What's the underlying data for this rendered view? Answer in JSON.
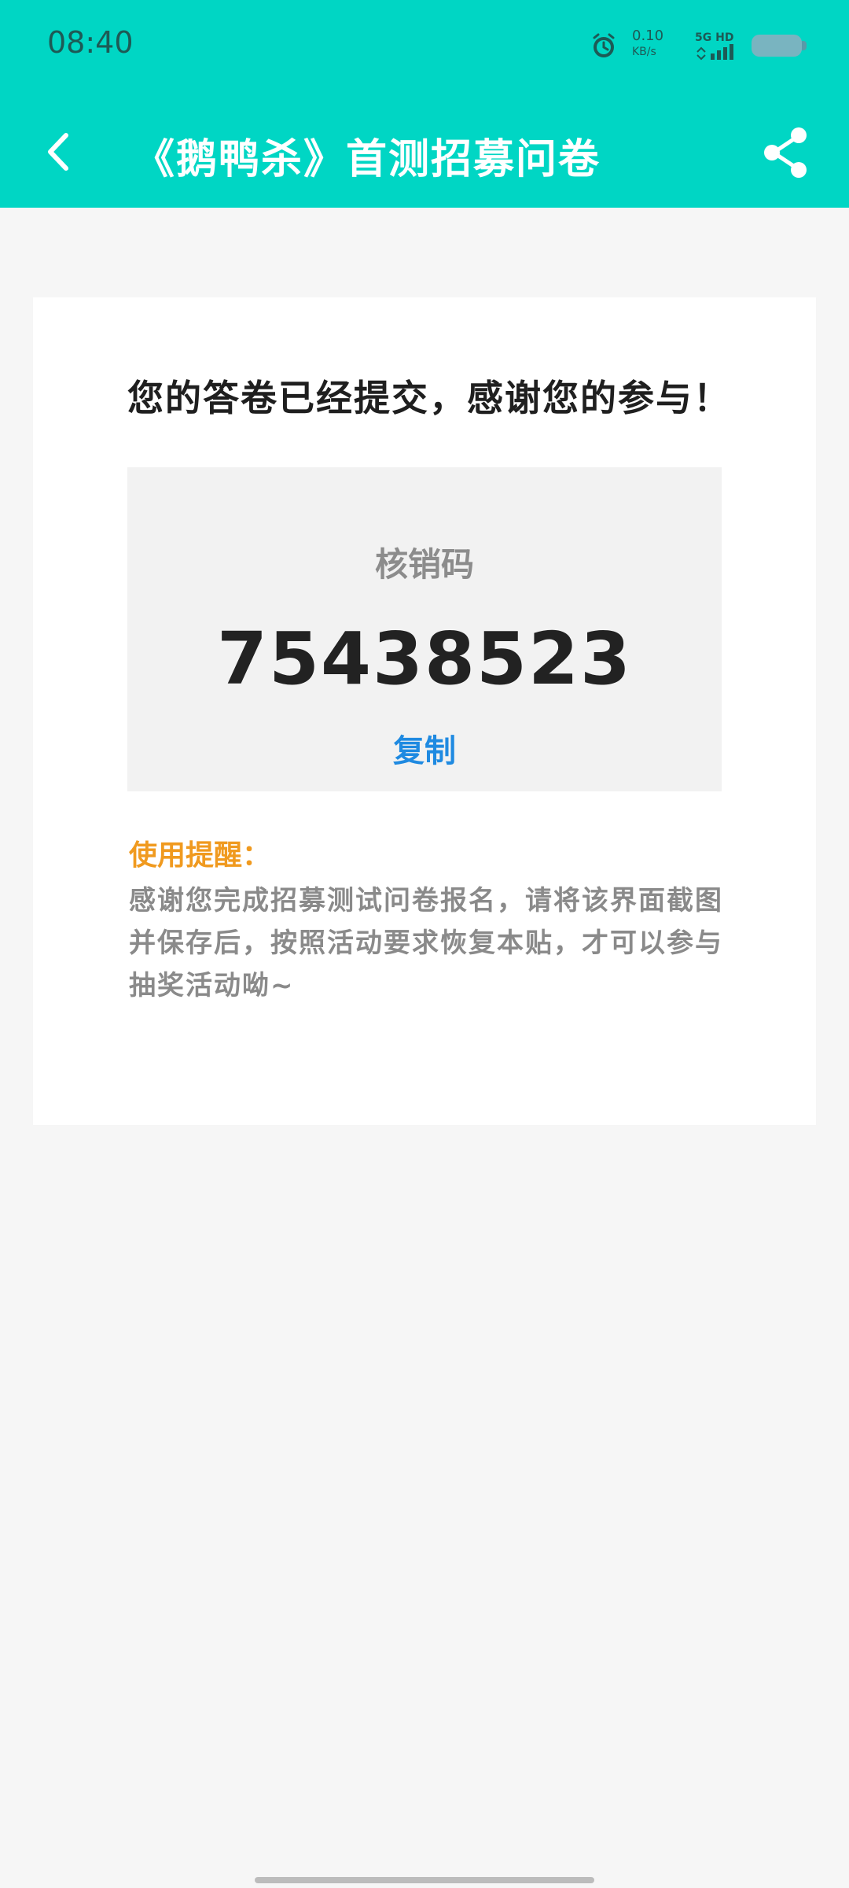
{
  "status_bar": {
    "time": "08:40",
    "network_speed_value": "0.10",
    "network_speed_unit": "KB/s",
    "network_type": "5G HD",
    "icons": [
      "alarm-icon",
      "signal-icon",
      "battery-icon"
    ]
  },
  "nav": {
    "title": "《鹅鸭杀》首测招募问卷",
    "back_icon": "chevron-left-icon",
    "share_icon": "share-icon"
  },
  "card": {
    "heading": "您的答卷已经提交，感谢您的参与！",
    "code_label": "核销码",
    "code_value": "75438523",
    "copy_label": "复制",
    "reminder_title": "使用提醒：",
    "reminder_body": "感谢您完成招募测试问卷报名，请将该界面截图并保存后，按照活动要求恢复本贴，才可以参与抽奖活动呦~"
  },
  "colors": {
    "header_bg": "#00d6c4",
    "page_bg": "#f6f6f6",
    "card_bg": "#ffffff",
    "code_box_bg": "#f2f2f2",
    "copy_link": "#1f8ae1",
    "reminder_title": "#f09a1f"
  }
}
